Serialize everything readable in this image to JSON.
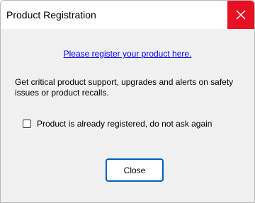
{
  "window": {
    "title": "Product Registration"
  },
  "content": {
    "register_link": "Please register your product here.",
    "description": "Get critical product support, upgrades and alerts on safety issues or product recalls.",
    "checkbox_label": "Product is already registered, do not ask again",
    "checkbox_checked": false,
    "close_button_label": "Close"
  },
  "colors": {
    "titlebar_close_bg": "#e81123",
    "link": "#0000ff",
    "button_focus_border": "#005fb8",
    "dialog_bg": "#f0f0f0"
  },
  "icons": {
    "titlebar_close": "close-icon"
  }
}
